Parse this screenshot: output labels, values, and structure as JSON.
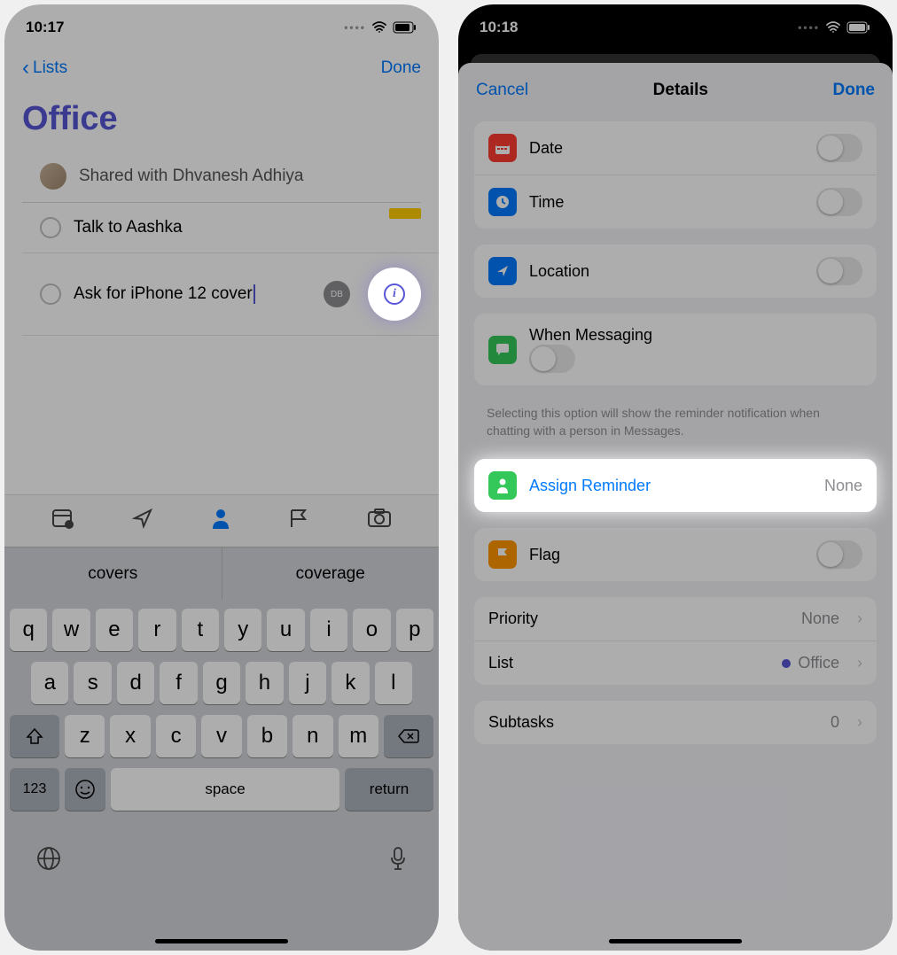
{
  "left": {
    "status": {
      "time": "10:17"
    },
    "nav": {
      "back": "Lists",
      "done": "Done"
    },
    "list_title": "Office",
    "shared_with": "Shared with Dhvanesh Adhiya",
    "reminders": [
      {
        "text": "Talk to Aashka"
      },
      {
        "text": "Ask for iPhone 12 cover",
        "assignee_initials": "DB"
      }
    ],
    "suggestions": [
      "covers",
      "coverage"
    ],
    "keyboard": {
      "row1": [
        "q",
        "w",
        "e",
        "r",
        "t",
        "y",
        "u",
        "i",
        "o",
        "p"
      ],
      "row2": [
        "a",
        "s",
        "d",
        "f",
        "g",
        "h",
        "j",
        "k",
        "l"
      ],
      "row3": [
        "z",
        "x",
        "c",
        "v",
        "b",
        "n",
        "m"
      ],
      "num": "123",
      "space": "space",
      "return": "return"
    }
  },
  "right": {
    "status": {
      "time": "10:18"
    },
    "header": {
      "cancel": "Cancel",
      "title": "Details",
      "done": "Done"
    },
    "cells": {
      "date": "Date",
      "time": "Time",
      "location": "Location",
      "messaging": "When Messaging",
      "messaging_help": "Selecting this option will show the reminder notification when chatting with a person in Messages.",
      "assign": "Assign Reminder",
      "assign_value": "None",
      "flag": "Flag",
      "priority": "Priority",
      "priority_value": "None",
      "list": "List",
      "list_value": "Office",
      "subtasks": "Subtasks",
      "subtasks_value": "0"
    }
  }
}
